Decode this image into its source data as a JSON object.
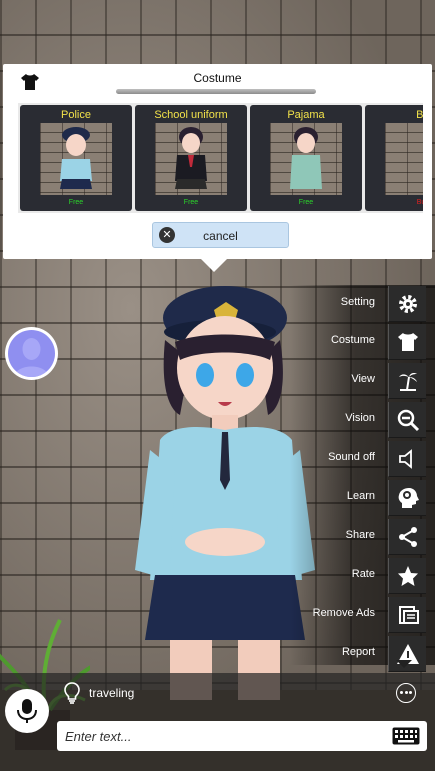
{
  "costume_panel": {
    "title": "Costume",
    "cards": [
      {
        "label": "Police",
        "price": "Free",
        "paid": false
      },
      {
        "label": "School uniform",
        "price": "Free",
        "paid": false
      },
      {
        "label": "Pajama",
        "price": "Free",
        "paid": false
      },
      {
        "label": "Bi",
        "price": "Bu",
        "paid": true
      }
    ],
    "cancel_label": "cancel"
  },
  "menu": {
    "items": [
      {
        "label": "Setting",
        "icon": "gear-icon"
      },
      {
        "label": "Costume",
        "icon": "shirt-icon"
      },
      {
        "label": "View",
        "icon": "palm-tree-icon"
      },
      {
        "label": "Vision",
        "icon": "zoom-out-icon"
      },
      {
        "label": "Sound off",
        "icon": "speaker-icon"
      },
      {
        "label": "Learn",
        "icon": "brain-head-icon"
      },
      {
        "label": "Share",
        "icon": "share-icon"
      },
      {
        "label": "Rate",
        "icon": "star-icon"
      },
      {
        "label": "Remove Ads",
        "icon": "no-ads-icon"
      },
      {
        "label": "Report",
        "icon": "warning-icon"
      }
    ]
  },
  "bottom": {
    "topic": "traveling",
    "input_placeholder": "Enter text..."
  },
  "colors": {
    "card_label": "#f2e24a",
    "free": "#2bd42b",
    "paid": "#e02020",
    "cancel_bg": "#cfe3f6",
    "menu_icon_bg": "#2b2b2b"
  }
}
